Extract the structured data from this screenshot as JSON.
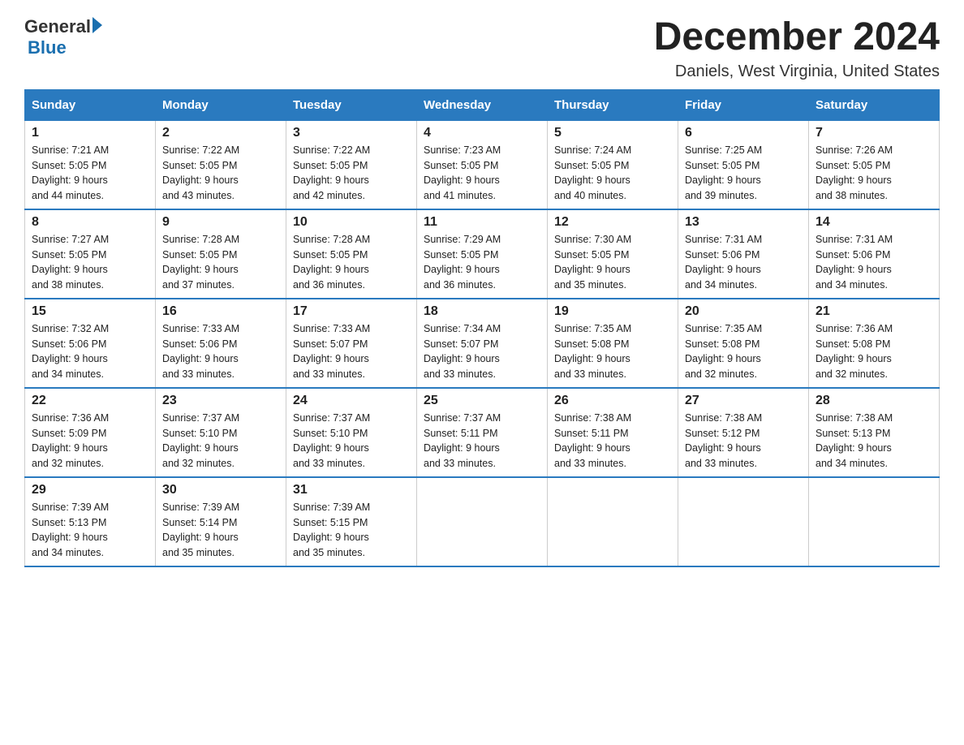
{
  "logo": {
    "text_general": "General",
    "text_blue": "Blue",
    "arrow": "▶"
  },
  "title": "December 2024",
  "subtitle": "Daniels, West Virginia, United States",
  "days_of_week": [
    "Sunday",
    "Monday",
    "Tuesday",
    "Wednesday",
    "Thursday",
    "Friday",
    "Saturday"
  ],
  "weeks": [
    [
      {
        "day": "1",
        "sunrise": "7:21 AM",
        "sunset": "5:05 PM",
        "daylight": "9 hours and 44 minutes."
      },
      {
        "day": "2",
        "sunrise": "7:22 AM",
        "sunset": "5:05 PM",
        "daylight": "9 hours and 43 minutes."
      },
      {
        "day": "3",
        "sunrise": "7:22 AM",
        "sunset": "5:05 PM",
        "daylight": "9 hours and 42 minutes."
      },
      {
        "day": "4",
        "sunrise": "7:23 AM",
        "sunset": "5:05 PM",
        "daylight": "9 hours and 41 minutes."
      },
      {
        "day": "5",
        "sunrise": "7:24 AM",
        "sunset": "5:05 PM",
        "daylight": "9 hours and 40 minutes."
      },
      {
        "day": "6",
        "sunrise": "7:25 AM",
        "sunset": "5:05 PM",
        "daylight": "9 hours and 39 minutes."
      },
      {
        "day": "7",
        "sunrise": "7:26 AM",
        "sunset": "5:05 PM",
        "daylight": "9 hours and 38 minutes."
      }
    ],
    [
      {
        "day": "8",
        "sunrise": "7:27 AM",
        "sunset": "5:05 PM",
        "daylight": "9 hours and 38 minutes."
      },
      {
        "day": "9",
        "sunrise": "7:28 AM",
        "sunset": "5:05 PM",
        "daylight": "9 hours and 37 minutes."
      },
      {
        "day": "10",
        "sunrise": "7:28 AM",
        "sunset": "5:05 PM",
        "daylight": "9 hours and 36 minutes."
      },
      {
        "day": "11",
        "sunrise": "7:29 AM",
        "sunset": "5:05 PM",
        "daylight": "9 hours and 36 minutes."
      },
      {
        "day": "12",
        "sunrise": "7:30 AM",
        "sunset": "5:05 PM",
        "daylight": "9 hours and 35 minutes."
      },
      {
        "day": "13",
        "sunrise": "7:31 AM",
        "sunset": "5:06 PM",
        "daylight": "9 hours and 34 minutes."
      },
      {
        "day": "14",
        "sunrise": "7:31 AM",
        "sunset": "5:06 PM",
        "daylight": "9 hours and 34 minutes."
      }
    ],
    [
      {
        "day": "15",
        "sunrise": "7:32 AM",
        "sunset": "5:06 PM",
        "daylight": "9 hours and 34 minutes."
      },
      {
        "day": "16",
        "sunrise": "7:33 AM",
        "sunset": "5:06 PM",
        "daylight": "9 hours and 33 minutes."
      },
      {
        "day": "17",
        "sunrise": "7:33 AM",
        "sunset": "5:07 PM",
        "daylight": "9 hours and 33 minutes."
      },
      {
        "day": "18",
        "sunrise": "7:34 AM",
        "sunset": "5:07 PM",
        "daylight": "9 hours and 33 minutes."
      },
      {
        "day": "19",
        "sunrise": "7:35 AM",
        "sunset": "5:08 PM",
        "daylight": "9 hours and 33 minutes."
      },
      {
        "day": "20",
        "sunrise": "7:35 AM",
        "sunset": "5:08 PM",
        "daylight": "9 hours and 32 minutes."
      },
      {
        "day": "21",
        "sunrise": "7:36 AM",
        "sunset": "5:08 PM",
        "daylight": "9 hours and 32 minutes."
      }
    ],
    [
      {
        "day": "22",
        "sunrise": "7:36 AM",
        "sunset": "5:09 PM",
        "daylight": "9 hours and 32 minutes."
      },
      {
        "day": "23",
        "sunrise": "7:37 AM",
        "sunset": "5:10 PM",
        "daylight": "9 hours and 32 minutes."
      },
      {
        "day": "24",
        "sunrise": "7:37 AM",
        "sunset": "5:10 PM",
        "daylight": "9 hours and 33 minutes."
      },
      {
        "day": "25",
        "sunrise": "7:37 AM",
        "sunset": "5:11 PM",
        "daylight": "9 hours and 33 minutes."
      },
      {
        "day": "26",
        "sunrise": "7:38 AM",
        "sunset": "5:11 PM",
        "daylight": "9 hours and 33 minutes."
      },
      {
        "day": "27",
        "sunrise": "7:38 AM",
        "sunset": "5:12 PM",
        "daylight": "9 hours and 33 minutes."
      },
      {
        "day": "28",
        "sunrise": "7:38 AM",
        "sunset": "5:13 PM",
        "daylight": "9 hours and 34 minutes."
      }
    ],
    [
      {
        "day": "29",
        "sunrise": "7:39 AM",
        "sunset": "5:13 PM",
        "daylight": "9 hours and 34 minutes."
      },
      {
        "day": "30",
        "sunrise": "7:39 AM",
        "sunset": "5:14 PM",
        "daylight": "9 hours and 35 minutes."
      },
      {
        "day": "31",
        "sunrise": "7:39 AM",
        "sunset": "5:15 PM",
        "daylight": "9 hours and 35 minutes."
      },
      null,
      null,
      null,
      null
    ]
  ],
  "labels": {
    "sunrise": "Sunrise:",
    "sunset": "Sunset:",
    "daylight": "Daylight:"
  }
}
